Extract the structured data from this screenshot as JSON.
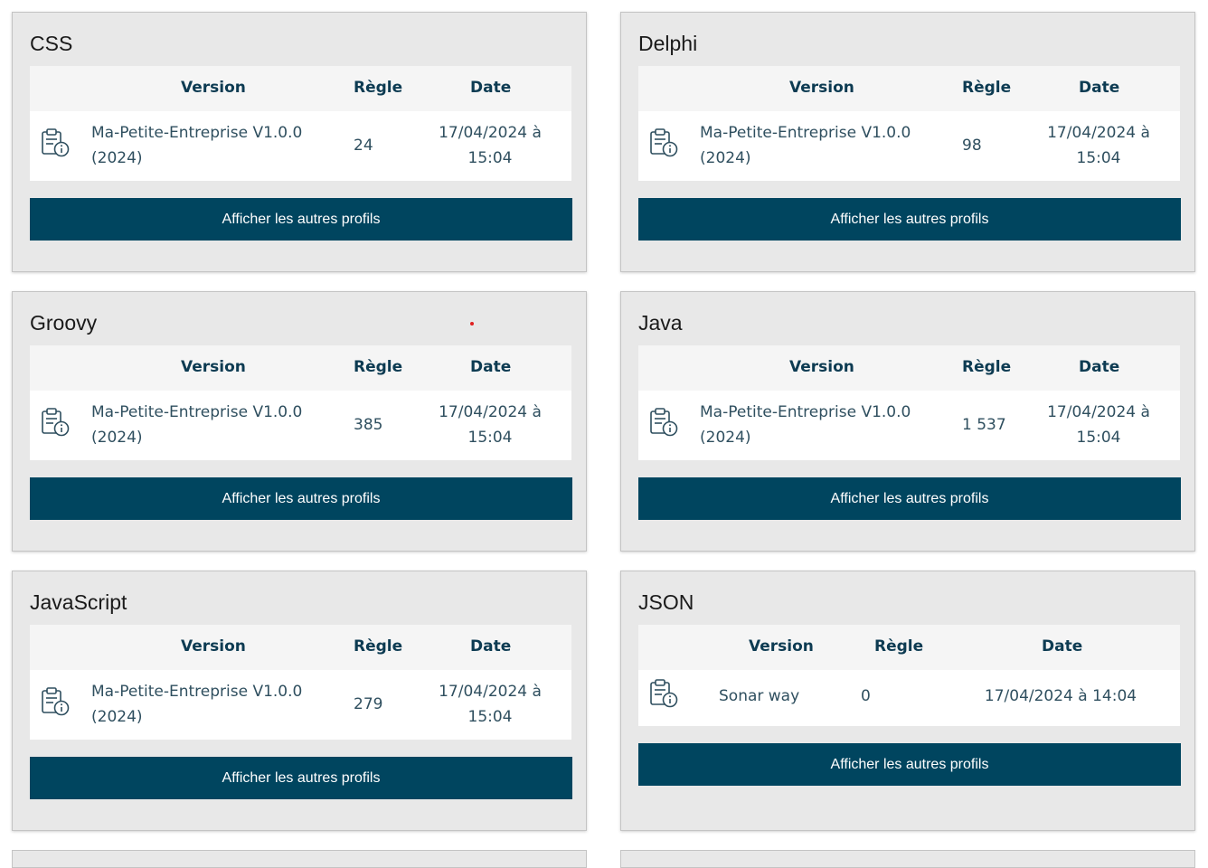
{
  "table_headers": {
    "version": "Version",
    "rule": "Règle",
    "date": "Date"
  },
  "button_label": "Afficher les autres profils",
  "icon": "clipboard-info-icon",
  "colors": {
    "button": "#00455f",
    "header_text": "#0d3b52",
    "card_bg": "#e8e8e8"
  },
  "cards": [
    {
      "title": "CSS",
      "version_line1": "Ma-Petite-Entreprise V1.0.0",
      "version_line2": "(2024)",
      "rules": "24",
      "date_line1": "17/04/2024 à",
      "date_line2": "15:04"
    },
    {
      "title": "Delphi",
      "version_line1": "Ma-Petite-Entreprise V1.0.0",
      "version_line2": "(2024)",
      "rules": "98",
      "date_line1": "17/04/2024 à",
      "date_line2": "15:04"
    },
    {
      "title": "Groovy",
      "version_line1": "Ma-Petite-Entreprise V1.0.0",
      "version_line2": "(2024)",
      "rules": "385",
      "date_line1": "17/04/2024 à",
      "date_line2": "15:04"
    },
    {
      "title": "Java",
      "version_line1": "Ma-Petite-Entreprise V1.0.0",
      "version_line2": "(2024)",
      "rules": "1 537",
      "date_line1": "17/04/2024 à",
      "date_line2": "15:04"
    },
    {
      "title": "JavaScript",
      "version_line1": "Ma-Petite-Entreprise V1.0.0",
      "version_line2": "(2024)",
      "rules": "279",
      "date_line1": "17/04/2024 à",
      "date_line2": "15:04"
    },
    {
      "title": "JSON",
      "version": "Sonar way",
      "rules": "0",
      "date": "17/04/2024 à 14:04"
    }
  ]
}
